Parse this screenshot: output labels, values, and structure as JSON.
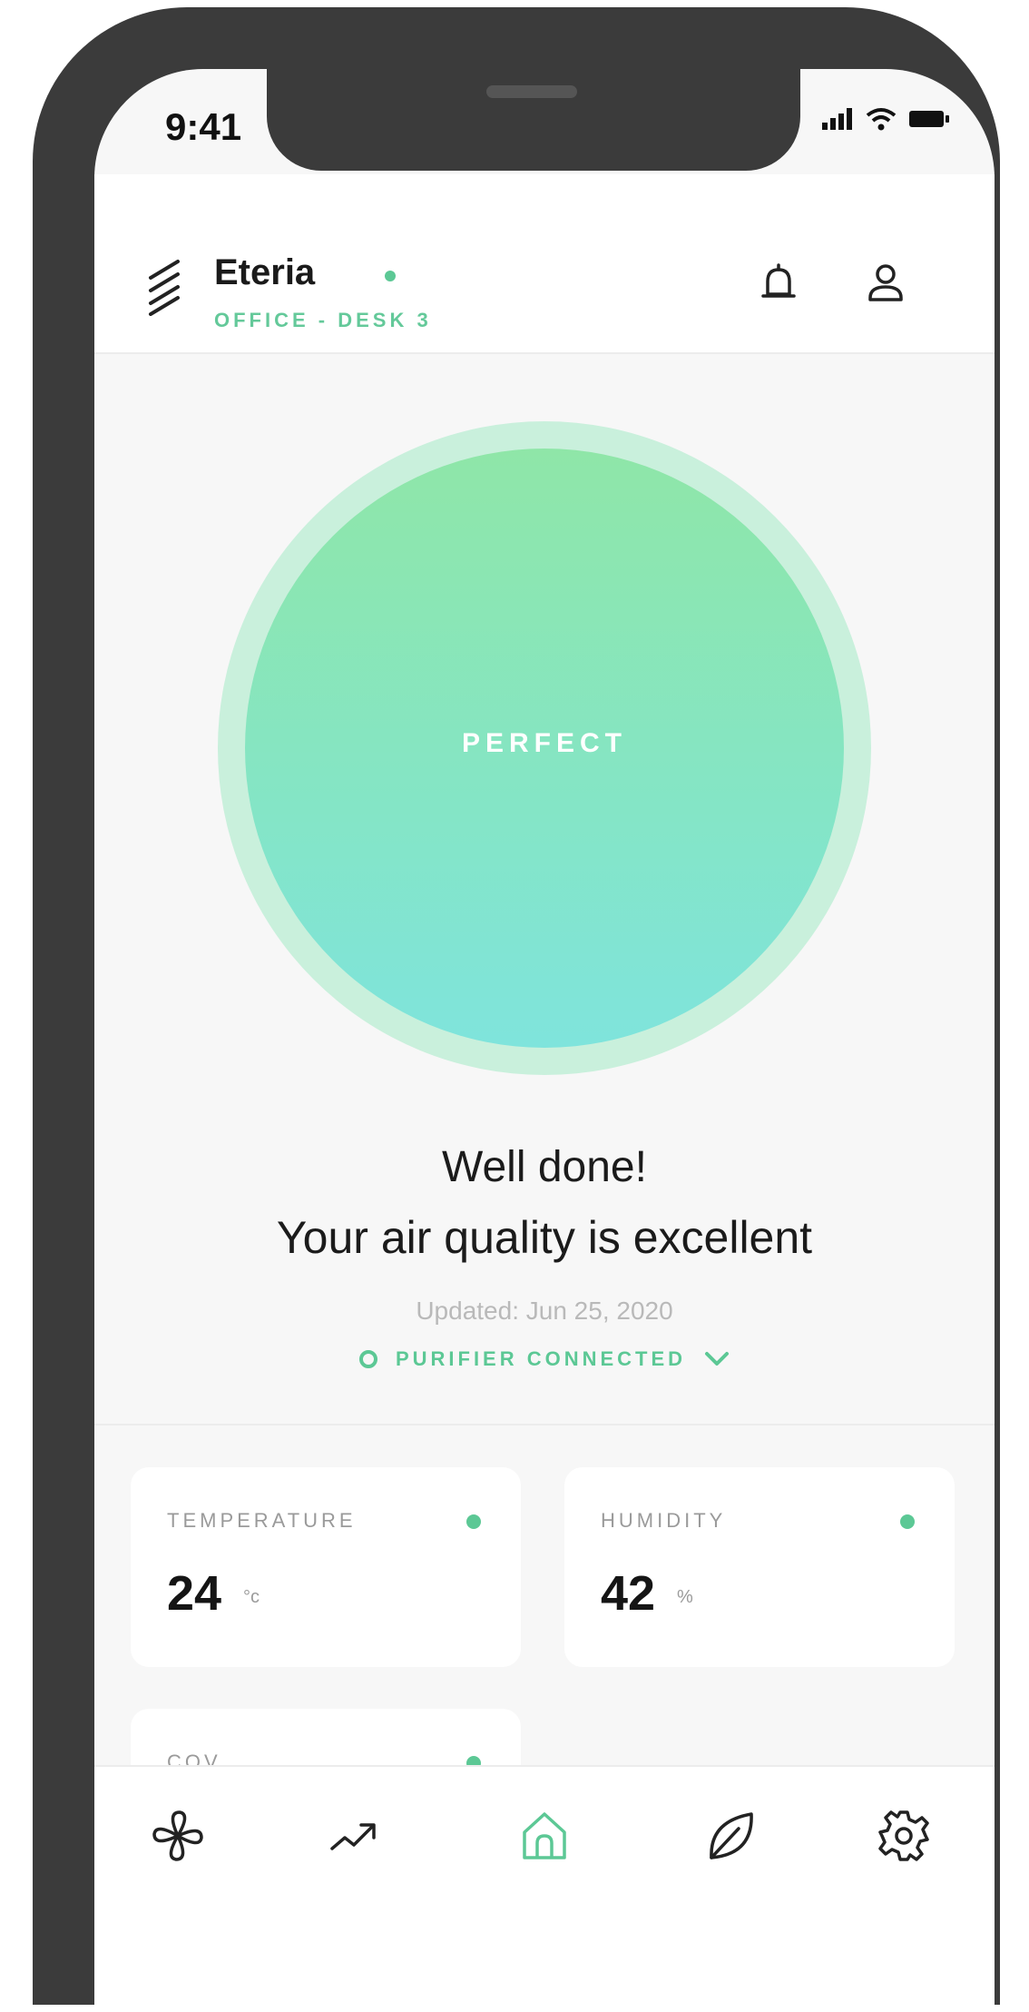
{
  "status_bar": {
    "time": "9:41"
  },
  "header": {
    "app_name": "Eteria",
    "location": "OFFICE - DESK 3"
  },
  "air_quality": {
    "label": "PERFECT",
    "message_line1": "Well done!",
    "message_line2": "Your air quality is excellent",
    "updated": "Updated: Jun 25, 2020",
    "connection": "PURIFIER CONNECTED"
  },
  "cards": [
    {
      "label": "TEMPERATURE",
      "value": "24",
      "unit": "°c"
    },
    {
      "label": "HUMIDITY",
      "value": "42",
      "unit": "%"
    },
    {
      "label": "COV"
    }
  ],
  "tabs": [
    {
      "icon": "fan-icon"
    },
    {
      "icon": "trend-icon"
    },
    {
      "icon": "home-icon",
      "active": true
    },
    {
      "icon": "leaf-icon"
    },
    {
      "icon": "gear-icon"
    }
  ],
  "colors": {
    "accent": "#5cc895",
    "circle_top": "#8fe6a8",
    "circle_bottom": "#7fe4dc",
    "frame": "#3b3b3b"
  }
}
